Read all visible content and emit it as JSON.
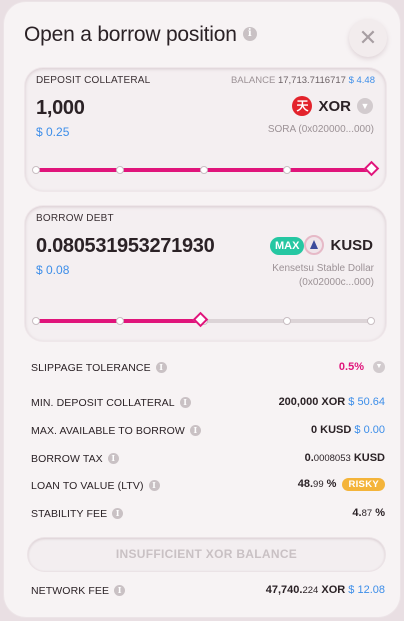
{
  "title": "Open a borrow position",
  "close_symbol": "✕",
  "deposit": {
    "label": "DEPOSIT COLLATERAL",
    "balance_label": "BALANCE",
    "balance_value": "17,713.7116717",
    "balance_usd": "$ 4.48",
    "amount": "1,000",
    "usd": "$ 0.25",
    "token": "XOR",
    "token_icon": "sora-xor-icon",
    "token_name": "SORA (0x020000...000)",
    "slider_percent": 100
  },
  "borrow": {
    "label": "BORROW DEBT",
    "amount": "0.080531953271930",
    "max_label": "MAX",
    "usd": "$ 0.08",
    "token": "KUSD",
    "token_icon": "kensetsu-kusd-icon",
    "token_name_line1": "Kensetsu Stable Dollar",
    "token_name_line2": "(0x02000c...000)",
    "slider_percent": 48.99
  },
  "details": {
    "slippage": {
      "label": "SLIPPAGE TOLERANCE",
      "value": "0.5%"
    },
    "min_deposit": {
      "label": "MIN. DEPOSIT COLLATERAL",
      "value": "200,000",
      "unit": "XOR",
      "usd": "$ 50.64"
    },
    "max_borrow": {
      "label": "MAX. AVAILABLE TO BORROW",
      "value": "0",
      "unit": "KUSD",
      "usd": "$ 0.00"
    },
    "borrow_tax": {
      "label": "BORROW TAX",
      "int": "0.",
      "frac": "0008053",
      "unit": "KUSD"
    },
    "ltv": {
      "label": "LOAN TO VALUE (LTV)",
      "int": "48.",
      "frac": "99",
      "unit": " %",
      "badge": "RISKY"
    },
    "stability_fee": {
      "label": "STABILITY FEE",
      "int": "4.",
      "frac": "87",
      "unit": " %"
    },
    "network_fee": {
      "label": "NETWORK FEE",
      "int": "47,740.",
      "frac": "224",
      "unit": "XOR",
      "usd": "$ 12.08"
    }
  },
  "action_button": "INSUFFICIENT XOR BALANCE",
  "colors": {
    "accent": "#e0147b",
    "usd": "#3d8ee9",
    "max": "#25c7a2",
    "risky": "#f4b43a"
  }
}
